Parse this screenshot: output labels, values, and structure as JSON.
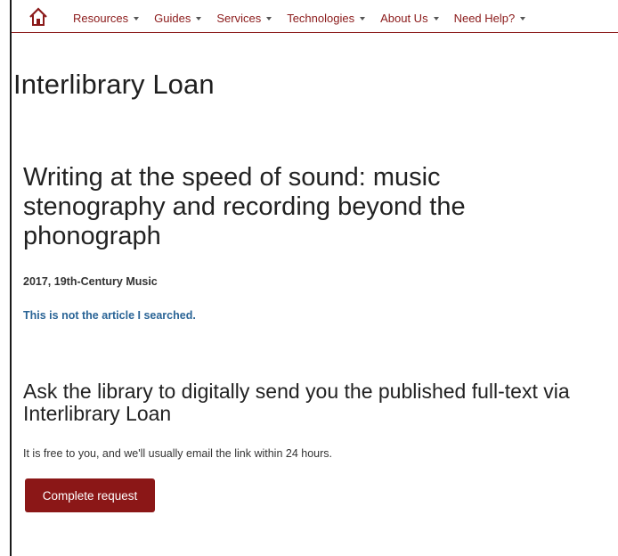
{
  "nav": {
    "home_icon": "home-icon",
    "items": [
      {
        "label": "Resources"
      },
      {
        "label": "Guides"
      },
      {
        "label": "Services"
      },
      {
        "label": "Technologies"
      },
      {
        "label": "About Us"
      },
      {
        "label": "Need Help?"
      }
    ]
  },
  "page": {
    "title": "Interlibrary Loan"
  },
  "article": {
    "title": "Writing at the speed of sound: music stenography and recording beyond the phonograph",
    "meta": "2017, 19th-Century Music",
    "not_article_link": "This is not the article I searched."
  },
  "request": {
    "heading": "Ask the library to digitally send you the published full-text via Interlibrary Loan",
    "note": "It is free to you, and we'll usually email the link within 24 hours.",
    "button_label": "Complete request"
  },
  "colors": {
    "brand": "#8b1717",
    "link": "#2a6496"
  }
}
